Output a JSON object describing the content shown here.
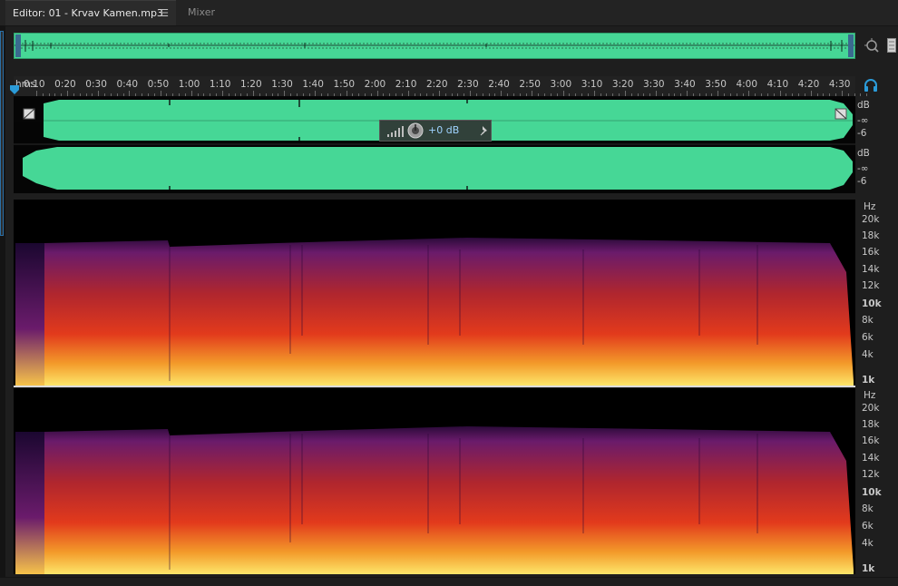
{
  "tabs": {
    "editor_label": "Editor: 01 - Krvav Kamen.mp3",
    "menu_glyph": "☰",
    "mixer_label": "Mixer"
  },
  "ruler": {
    "unit": "hms",
    "labels": [
      "0:10",
      "0:20",
      "0:30",
      "0:40",
      "0:50",
      "1:00",
      "1:10",
      "1:20",
      "1:30",
      "1:40",
      "1:50",
      "2:00",
      "2:10",
      "2:20",
      "2:30",
      "2:40",
      "2:50",
      "3:00",
      "3:10",
      "3:20",
      "3:30",
      "3:40",
      "3:50",
      "4:00",
      "4:10",
      "4:20",
      "4:30"
    ]
  },
  "hud": {
    "gain_value": "+0 dB"
  },
  "waveform_scale": {
    "ch1": [
      "dB",
      "-∞",
      "-6"
    ],
    "ch2": [
      "dB",
      "-∞",
      "-6"
    ]
  },
  "spectral_scale": {
    "ch1": [
      "Hz",
      "20k",
      "18k",
      "16k",
      "14k",
      "12k",
      "10k",
      "8k",
      "6k",
      "4k",
      "1k"
    ],
    "ch2": [
      "Hz",
      "20k",
      "18k",
      "16k",
      "14k",
      "12k",
      "10k",
      "8k",
      "6k",
      "4k",
      "1k"
    ]
  },
  "colors": {
    "waveform": "#46d796",
    "accent": "#2b9bd8",
    "hud_value": "#9fd3ff"
  },
  "icons": {
    "zoom": "zoom-icon",
    "headphones": "headphones-icon",
    "pin": "pin-icon",
    "volume": "volume-bars-icon",
    "knob": "knob-icon"
  }
}
